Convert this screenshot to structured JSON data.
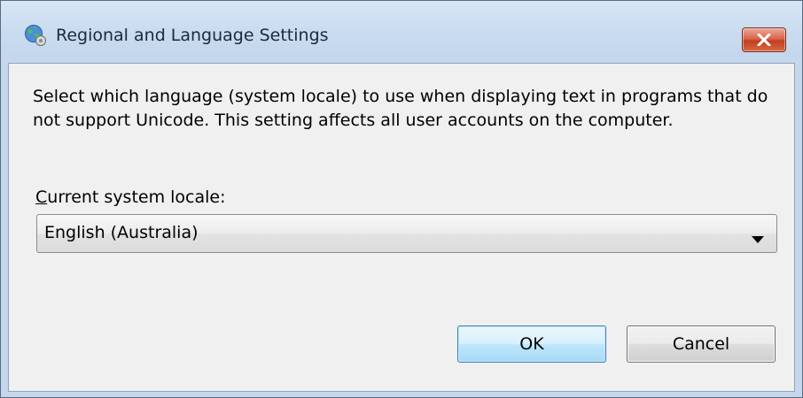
{
  "window": {
    "title": "Regional and Language Settings",
    "icon": "globe-settings-icon",
    "close_icon": "close-icon"
  },
  "content": {
    "description": "Select which language (system locale) to use when displaying text in programs that do not support Unicode. This setting affects all user accounts on the computer.",
    "locale_label_access_key": "C",
    "locale_label_rest": "urrent system locale:",
    "locale_value": "English (Australia)"
  },
  "buttons": {
    "ok_label": "OK",
    "cancel_label": "Cancel"
  },
  "colors": {
    "close_button": "#c1401f",
    "ok_border": "#3c7fb1",
    "client_background": "#f0f0f0"
  }
}
